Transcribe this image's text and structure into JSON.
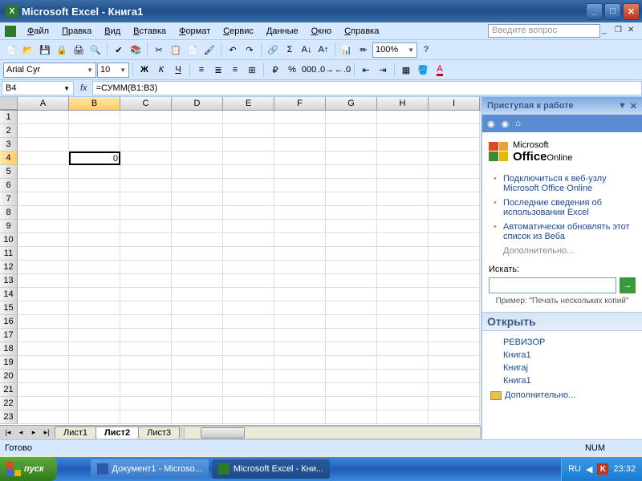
{
  "title": "Microsoft Excel - Книга1",
  "menu": [
    "Файл",
    "Правка",
    "Вид",
    "Вставка",
    "Формат",
    "Сервис",
    "Данные",
    "Окно",
    "Справка"
  ],
  "question_placeholder": "Введите вопрос",
  "font": {
    "name": "Arial Cyr",
    "size": "10"
  },
  "zoom": "100%",
  "namebox": "B4",
  "formula": "=СУММ(B1:B3)",
  "columns": [
    "A",
    "B",
    "C",
    "D",
    "E",
    "F",
    "G",
    "H",
    "I"
  ],
  "active": {
    "row": 4,
    "col": "B",
    "value": "0"
  },
  "sheets": [
    "Лист1",
    "Лист2",
    "Лист3"
  ],
  "active_sheet": 1,
  "taskpane": {
    "title": "Приступая к работе",
    "brand_top": "Microsoft",
    "brand": "Office",
    "brand_suffix": "Online",
    "links": [
      "Подключиться к веб-узлу Microsoft Office Online",
      "Последние сведения об использовании Excel",
      "Автоматически обновлять этот список из Веба"
    ],
    "more": "Дополнительно...",
    "search_label": "Искать:",
    "hint": "Пример: \"Печать нескольких копий\"",
    "open_header": "Открыть",
    "files": [
      "РЕВИЗОР",
      "Книга1",
      "Книгај",
      "Книга1"
    ],
    "open_more": "Дополнительно..."
  },
  "status": "Готово",
  "status_num": "NUM",
  "taskbar": {
    "start": "пуск",
    "items": [
      "Документ1 - Microso...",
      "Microsoft Excel - Кни..."
    ],
    "lang": "RU",
    "time": "23:32"
  }
}
